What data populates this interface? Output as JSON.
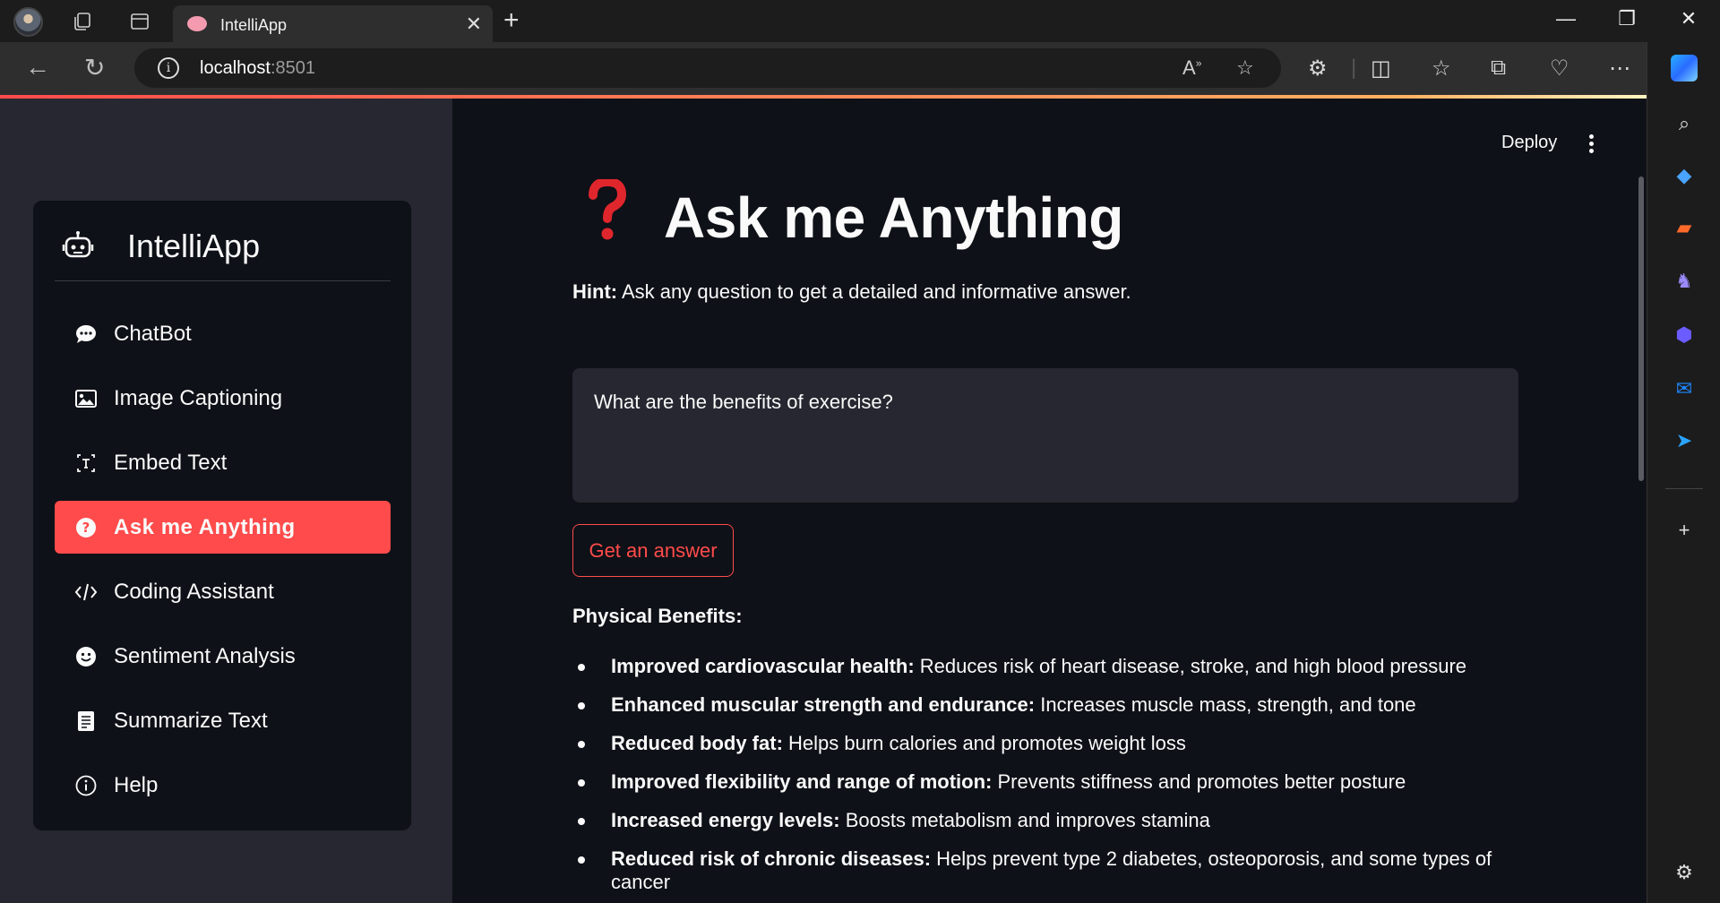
{
  "browser": {
    "tab_title": "IntelliApp",
    "url_host": "localhost",
    "url_port": ":8501"
  },
  "header": {
    "deploy_label": "Deploy"
  },
  "sidebar": {
    "brand": "IntelliApp",
    "items": [
      {
        "label": "ChatBot",
        "icon": "chat-icon"
      },
      {
        "label": "Image Captioning",
        "icon": "image-icon"
      },
      {
        "label": "Embed Text",
        "icon": "text-embed-icon"
      },
      {
        "label": "Ask me Anything",
        "icon": "question-circle-icon",
        "active": true
      },
      {
        "label": "Coding Assistant",
        "icon": "code-icon"
      },
      {
        "label": "Sentiment Analysis",
        "icon": "smiley-icon"
      },
      {
        "label": "Summarize Text",
        "icon": "document-icon"
      },
      {
        "label": "Help",
        "icon": "info-icon"
      }
    ]
  },
  "main": {
    "title": "Ask me Anything",
    "hint_label": "Hint:",
    "hint_text": " Ask any question to get a detailed and informative answer.",
    "question_value": "What are the benefits of exercise?",
    "button_label": "Get an answer",
    "section_heading": "Physical Benefits:",
    "benefits": [
      {
        "term": "Improved cardiovascular health:",
        "desc": " Reduces risk of heart disease, stroke, and high blood pressure"
      },
      {
        "term": "Enhanced muscular strength and endurance:",
        "desc": " Increases muscle mass, strength, and tone"
      },
      {
        "term": "Reduced body fat:",
        "desc": " Helps burn calories and promotes weight loss"
      },
      {
        "term": "Improved flexibility and range of motion:",
        "desc": " Prevents stiffness and promotes better posture"
      },
      {
        "term": "Increased energy levels:",
        "desc": " Boosts metabolism and improves stamina"
      },
      {
        "term": "Reduced risk of chronic diseases:",
        "desc": " Helps prevent type 2 diabetes, osteoporosis, and some types of cancer"
      }
    ]
  },
  "colors": {
    "accent": "#ff4b4b",
    "background": "#0e1117",
    "sidebar": "#262730"
  }
}
